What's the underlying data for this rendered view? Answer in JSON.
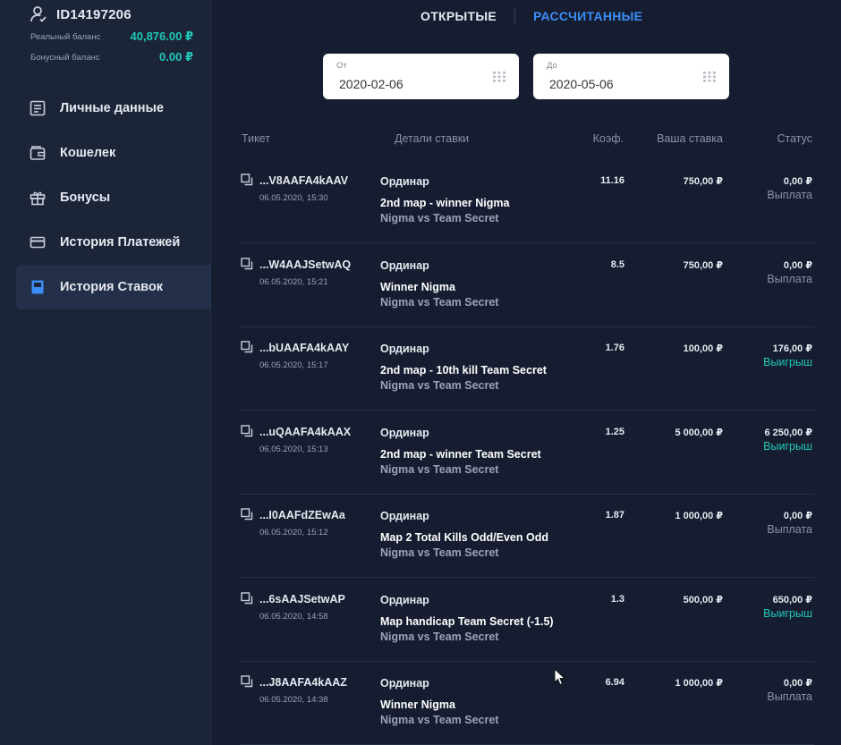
{
  "account": {
    "user_id": "ID14197206",
    "real_balance_label": "Реальный баланс",
    "real_balance_value": "40,876.00 ₽",
    "bonus_balance_label": "Бонусный баланс",
    "bonus_balance_value": "0.00 ₽"
  },
  "sidebar": {
    "items": [
      {
        "label": "Личные данные",
        "icon": "profile-doc-icon"
      },
      {
        "label": "Кошелек",
        "icon": "wallet-icon"
      },
      {
        "label": "Бонусы",
        "icon": "gift-icon"
      },
      {
        "label": "История Платежей",
        "icon": "card-icon"
      },
      {
        "label": "История Ставок",
        "icon": "bet-slip-icon",
        "active": true
      }
    ]
  },
  "tabs": {
    "open": "ОТКРЫТЫЕ",
    "calculated": "РАССЧИТАННЫЕ",
    "active": "calculated"
  },
  "filters": {
    "from_label": "От",
    "from_value": "2020-02-06",
    "to_label": "До",
    "to_value": "2020-05-06"
  },
  "table": {
    "headers": {
      "ticket": "Тикет",
      "details": "Детали ставки",
      "coef": "Коэф.",
      "stake": "Ваша ставка",
      "status": "Статус"
    },
    "rows": [
      {
        "ticket": "...V8AAFA4kAAV",
        "date": "06.05.2020, 15:30",
        "type": "Ординар",
        "market": "2nd map - winner Nigma",
        "event": "Nigma vs Team Secret",
        "coef": "11.16",
        "stake": "750,00 ₽",
        "payout": "0,00 ₽",
        "status": "Выплата",
        "win": false
      },
      {
        "ticket": "...W4AAJSetwAQ",
        "date": "06.05.2020, 15:21",
        "type": "Ординар",
        "market": "Winner Nigma",
        "event": "Nigma vs Team Secret",
        "coef": "8.5",
        "stake": "750,00 ₽",
        "payout": "0,00 ₽",
        "status": "Выплата",
        "win": false
      },
      {
        "ticket": "...bUAAFA4kAAY",
        "date": "06.05.2020, 15:17",
        "type": "Ординар",
        "market": "2nd map - 10th kill Team Secret",
        "event": "Nigma vs Team Secret",
        "coef": "1.76",
        "stake": "100,00 ₽",
        "payout": "176,00 ₽",
        "status": "Выигрыш",
        "win": true
      },
      {
        "ticket": "...uQAAFA4kAAX",
        "date": "06.05.2020, 15:13",
        "type": "Ординар",
        "market": "2nd map - winner Team Secret",
        "event": "Nigma vs Team Secret",
        "coef": "1.25",
        "stake": "5 000,00 ₽",
        "payout": "6 250,00 ₽",
        "status": "Выигрыш",
        "win": true
      },
      {
        "ticket": "...I0AAFdZEwAa",
        "date": "06.05.2020, 15:12",
        "type": "Ординар",
        "market": "Map 2 Total Kills Odd/Even Odd",
        "event": "Nigma vs Team Secret",
        "coef": "1.87",
        "stake": "1 000,00 ₽",
        "payout": "0,00 ₽",
        "status": "Выплата",
        "win": false
      },
      {
        "ticket": "...6sAAJSetwAP",
        "date": "06.05.2020, 14:58",
        "type": "Ординар",
        "market": "Map handicap Team Secret (-1.5)",
        "event": "Nigma vs Team Secret",
        "coef": "1.3",
        "stake": "500,00 ₽",
        "payout": "650,00 ₽",
        "status": "Выигрыш",
        "win": true
      },
      {
        "ticket": "...J8AAFA4kAAZ",
        "date": "06.05.2020, 14:38",
        "type": "Ординар",
        "market": "Winner Nigma",
        "event": "Nigma vs Team Secret",
        "coef": "6.94",
        "stake": "1 000,00 ₽",
        "payout": "0,00 ₽",
        "status": "Выплата",
        "win": false
      }
    ]
  },
  "colors": {
    "accent": "#3a8ef6",
    "win": "#1fc9b8",
    "balance": "#1fc9b8",
    "background": "#161d30",
    "sidebar": "#1c2438"
  }
}
